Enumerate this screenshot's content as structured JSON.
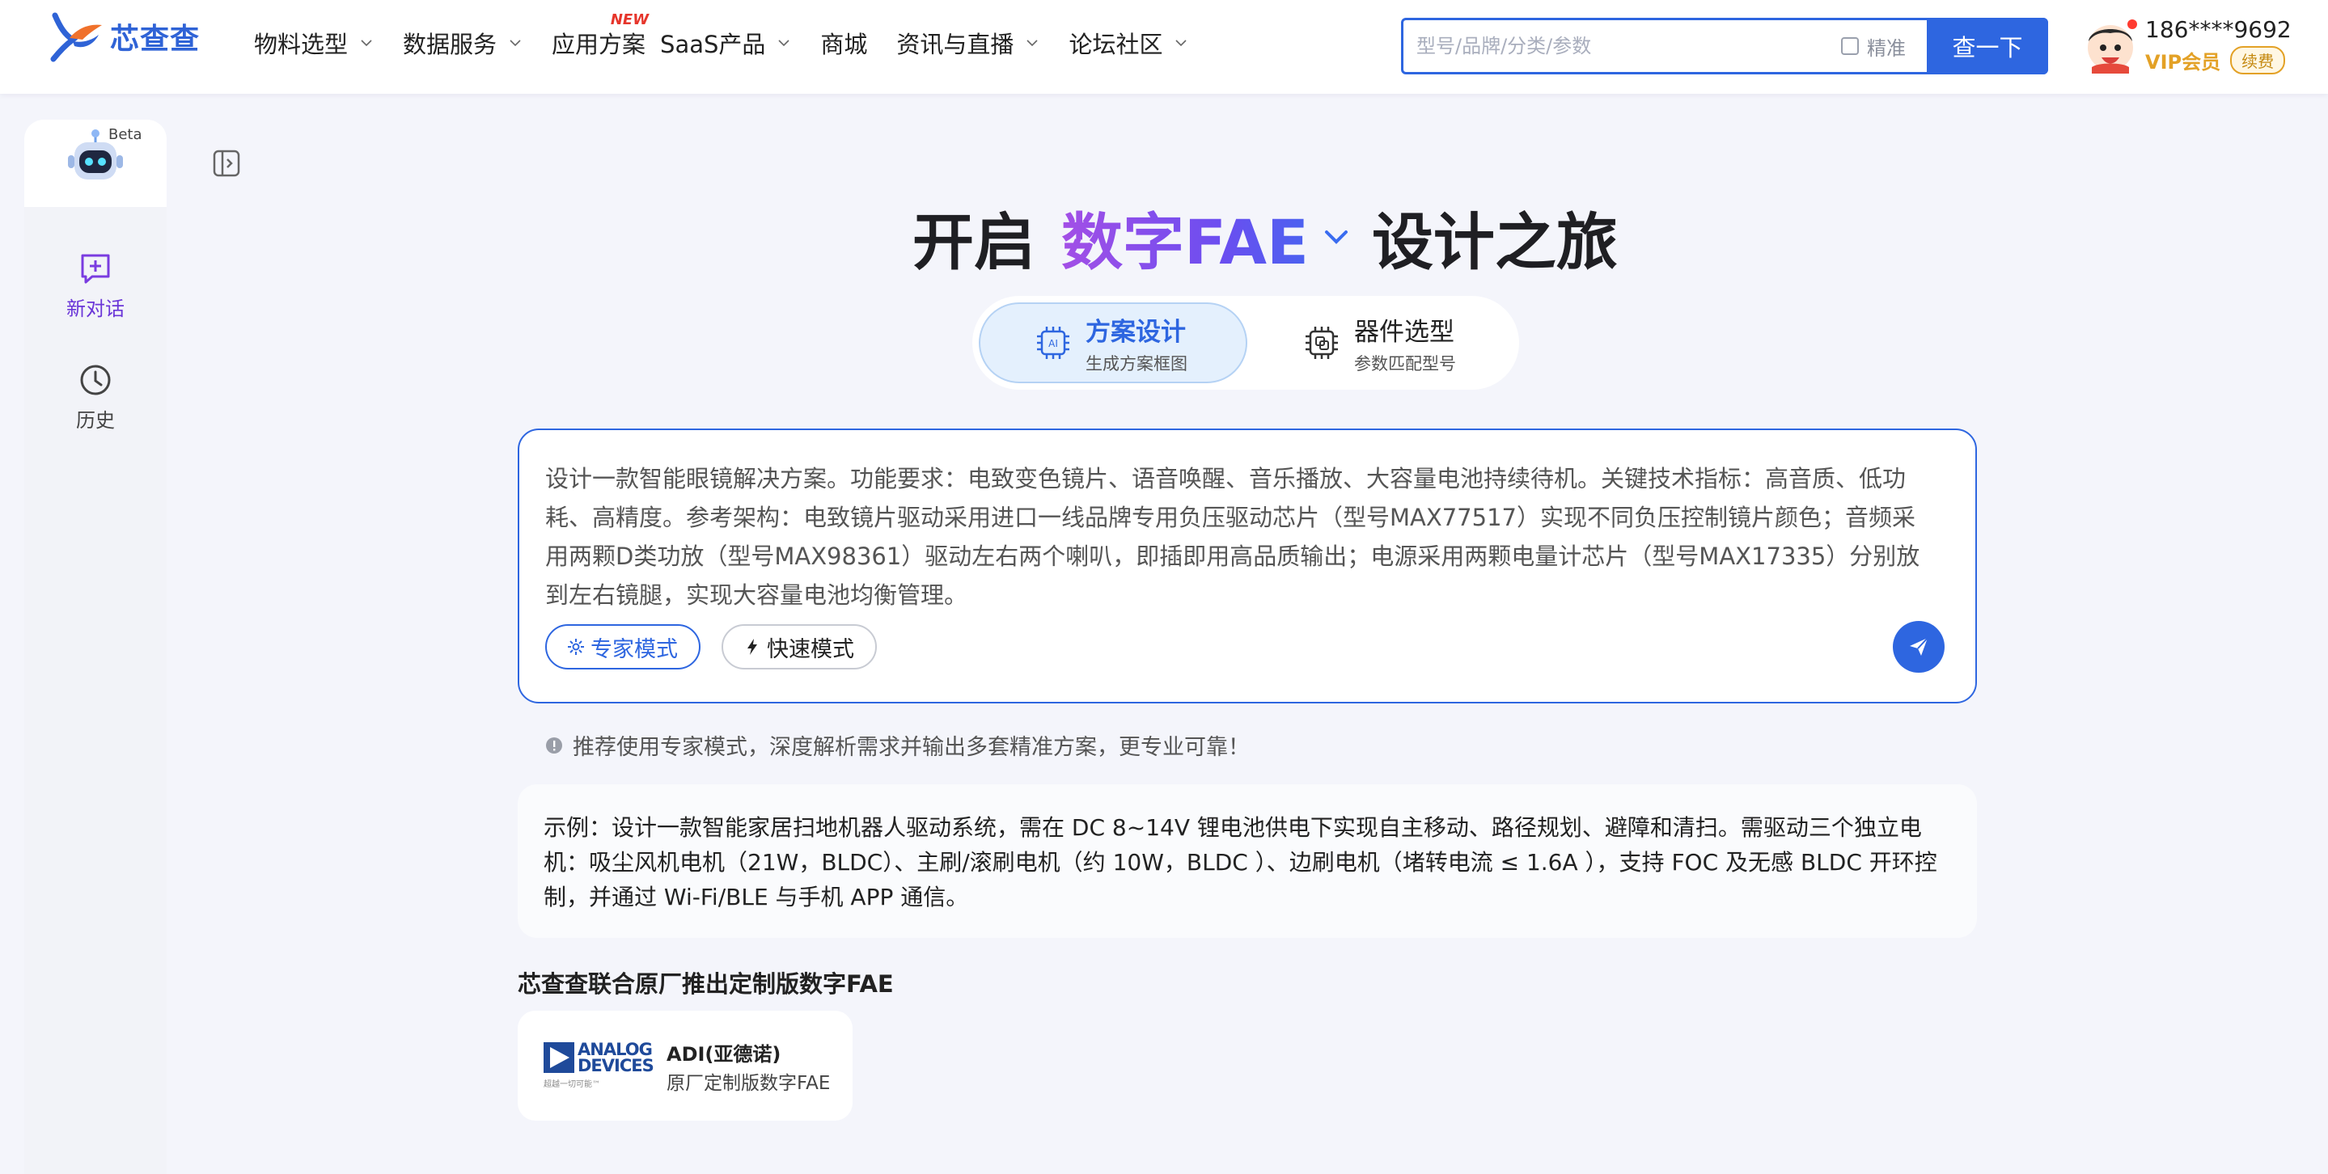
{
  "brand": {
    "name": "芯查查"
  },
  "nav": {
    "items": [
      {
        "label": "物料选型",
        "has_dropdown": true,
        "badge": ""
      },
      {
        "label": "数据服务",
        "has_dropdown": true,
        "badge": ""
      },
      {
        "label": "应用方案",
        "has_dropdown": false,
        "badge": "NEW"
      },
      {
        "label": "SaaS产品",
        "has_dropdown": true,
        "badge": ""
      },
      {
        "label": "商城",
        "has_dropdown": false,
        "badge": ""
      },
      {
        "label": "资讯与直播",
        "has_dropdown": true,
        "badge": ""
      },
      {
        "label": "论坛社区",
        "has_dropdown": true,
        "badge": ""
      }
    ]
  },
  "search": {
    "placeholder": "型号/品牌/分类/参数",
    "precise_label": "精准",
    "button_label": "查一下"
  },
  "user": {
    "phone": "186****9692",
    "vip_label": "VIP会员",
    "renew_label": "续费"
  },
  "sidebar": {
    "beta_label": "Beta",
    "new_chat_label": "新对话",
    "history_label": "历史"
  },
  "hero": {
    "prefix": "开启",
    "accent": "数字FAE",
    "suffix": "设计之旅"
  },
  "modes": {
    "tabs": [
      {
        "title": "方案设计",
        "subtitle": "生成方案框图",
        "active": true
      },
      {
        "title": "器件选型",
        "subtitle": "参数匹配型号",
        "active": false
      }
    ]
  },
  "composer": {
    "text": "设计一款智能眼镜解决方案。功能要求：电致变色镜片、语音唤醒、音乐播放、大容量电池持续待机。关键技术指标：高音质、低功耗、高精度。参考架构：电致镜片驱动采用进口一线品牌专用负压驱动芯片（型号MAX77517）实现不同负压控制镜片颜色；音频采用两颗D类功放（型号MAX98361）驱动左右两个喇叭，即插即用高品质输出；电源采用两颗电量计芯片（型号MAX17335）分别放到左右镜腿，实现大容量电池均衡管理。",
    "expert_label": "专家模式",
    "fast_label": "快速模式"
  },
  "tip": {
    "text": "推荐使用专家模式，深度解析需求并输出多套精准方案，更专业可靠！"
  },
  "example": {
    "text": "示例：设计一款智能家居扫地机器人驱动系统，需在 DC 8~14V 锂电池供电下实现自主移动、路径规划、避障和清扫。需驱动三个独立电机：吸尘风机电机（21W，BLDC）、主刷/滚刷电机（约 10W，BLDC ）、边刷电机（堵转电流 ≤ 1.6A ），支持 FOC 及无感 BLDC 开环控制，并通过 Wi-Fi/BLE 与手机 APP 通信。"
  },
  "fae": {
    "section_title": "芯查查联合原厂推出定制版数字FAE",
    "cards": [
      {
        "logo_line1": "ANALOG",
        "logo_line2": "DEVICES",
        "logo_tagline": "超越一切可能™",
        "name": "ADI(亚德诺)",
        "desc": "原厂定制版数字FAE"
      }
    ]
  },
  "colors": {
    "primary": "#2e66e0",
    "accent_purple": "#7b3fe4",
    "vip_gold": "#e3a126",
    "badge_red": "#e6352b"
  }
}
